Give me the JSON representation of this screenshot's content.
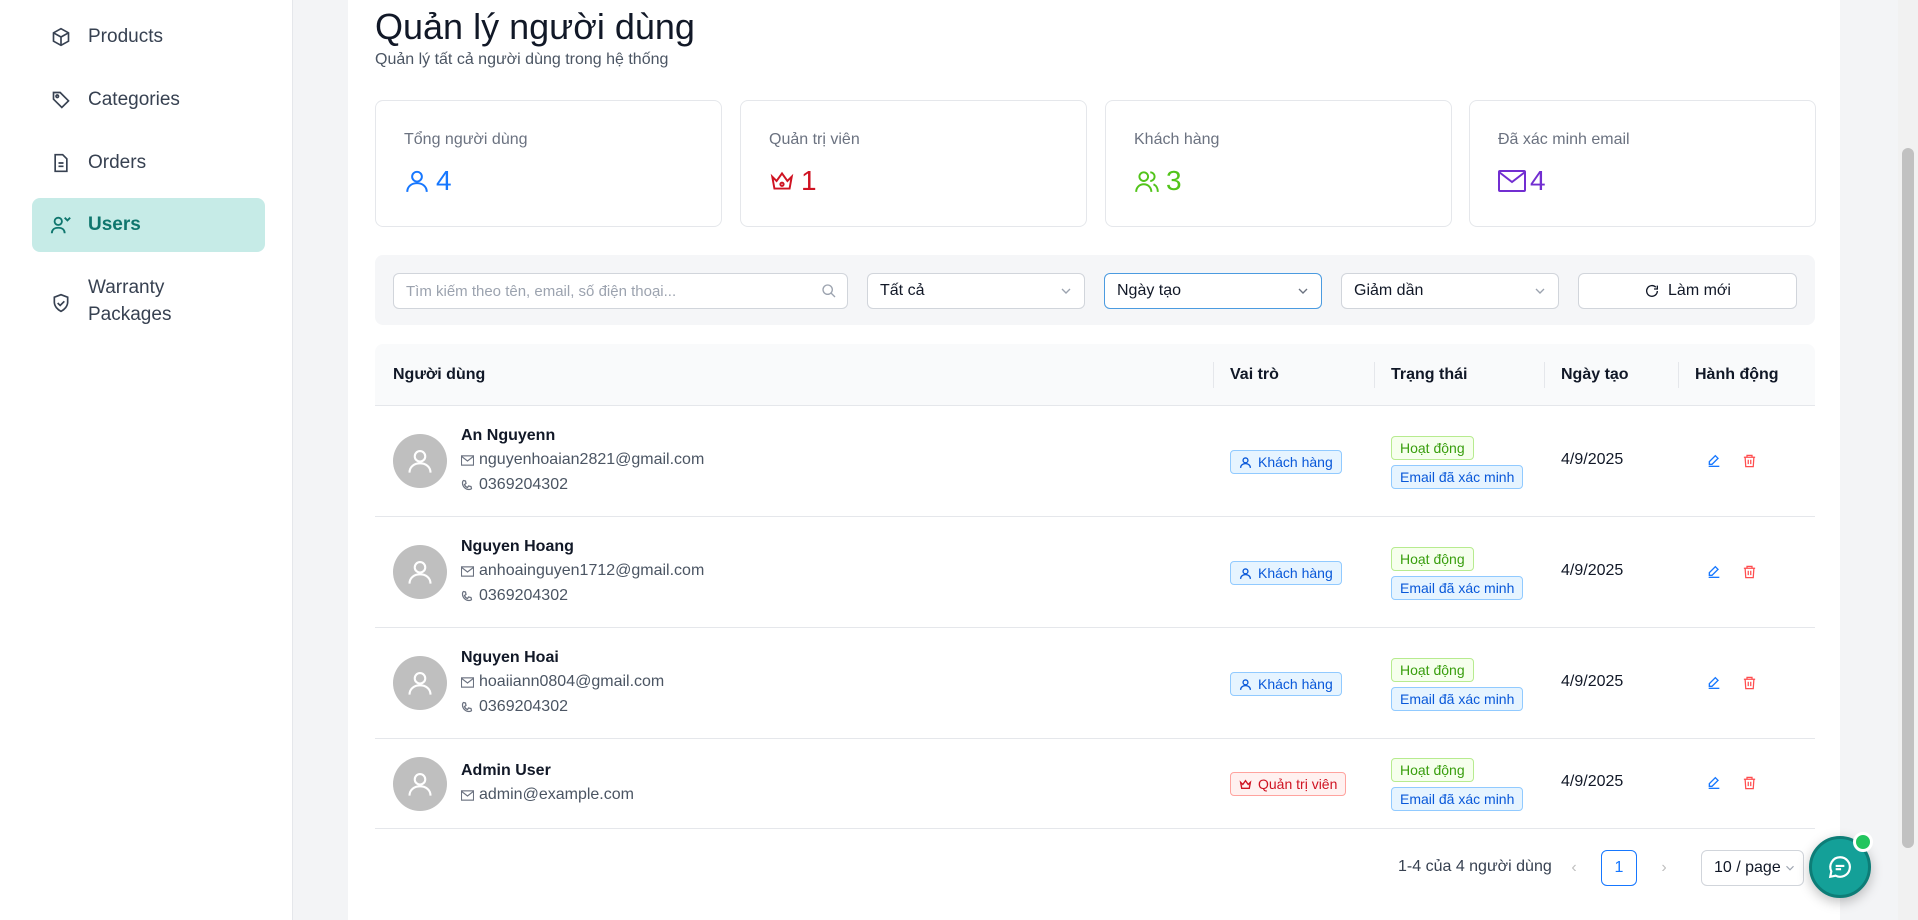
{
  "sidebar": {
    "items": [
      {
        "label": "Products",
        "icon": "cube-icon"
      },
      {
        "label": "Categories",
        "icon": "tag-icon"
      },
      {
        "label": "Orders",
        "icon": "document-icon"
      },
      {
        "label": "Users",
        "icon": "users-icon",
        "active": true
      },
      {
        "label_line1": "Warranty",
        "label_line2": "Packages",
        "icon": "shield-check-icon"
      }
    ]
  },
  "header": {
    "title": "Quản lý người dùng",
    "subtitle": "Quản lý tất cả người dùng trong hệ thống"
  },
  "stats": [
    {
      "label": "Tổng người dùng",
      "value": "4",
      "icon": "user-icon",
      "color": "#1677ff"
    },
    {
      "label": "Quản trị viên",
      "value": "1",
      "icon": "crown-icon",
      "color": "#cf1322"
    },
    {
      "label": "Khách hàng",
      "value": "3",
      "icon": "team-icon",
      "color": "#52c41a"
    },
    {
      "label": "Đã xác minh email",
      "value": "4",
      "icon": "mail-icon",
      "color": "#722ed1"
    }
  ],
  "filters": {
    "search_placeholder": "Tìm kiếm theo tên, email, số điện thoại...",
    "role_value": "Tất cả",
    "sort_field_value": "Ngày tạo",
    "sort_order_value": "Giảm dần",
    "refresh_label": "Làm mới"
  },
  "table": {
    "headers": {
      "user": "Người dùng",
      "role": "Vai trò",
      "status": "Trạng thái",
      "created": "Ngày tạo",
      "actions": "Hành động"
    },
    "rows": [
      {
        "name": "An Nguyenn",
        "email": "nguyenhoaian2821@gmail.com",
        "phone": "0369204302",
        "role": "Khách hàng",
        "status_active": "Hoạt động",
        "status_email": "Email đã xác minh",
        "created": "4/9/2025"
      },
      {
        "name": "Nguyen Hoang",
        "email": "anhoainguyen1712@gmail.com",
        "phone": "0369204302",
        "role": "Khách hàng",
        "status_active": "Hoạt động",
        "status_email": "Email đã xác minh",
        "created": "4/9/2025"
      },
      {
        "name": "Nguyen Hoai",
        "email": "hoaiiann0804@gmail.com",
        "phone": "0369204302",
        "role": "Khách hàng",
        "status_active": "Hoạt động",
        "status_email": "Email đã xác minh",
        "created": "4/9/2025"
      },
      {
        "name": "Admin User",
        "email": "admin@example.com",
        "role": "Quản trị viên",
        "status_active": "Hoạt động",
        "status_email": "Email đã xác minh",
        "created": "4/9/2025"
      }
    ]
  },
  "pagination": {
    "summary": "1-4 của 4 người dùng",
    "prev": "‹",
    "current_page": "1",
    "next": "›",
    "page_size": "10 / page"
  },
  "colors": {
    "accent": "#0f766e",
    "active_nav_bg": "#c6ebe7",
    "primary": "#1677ff"
  }
}
